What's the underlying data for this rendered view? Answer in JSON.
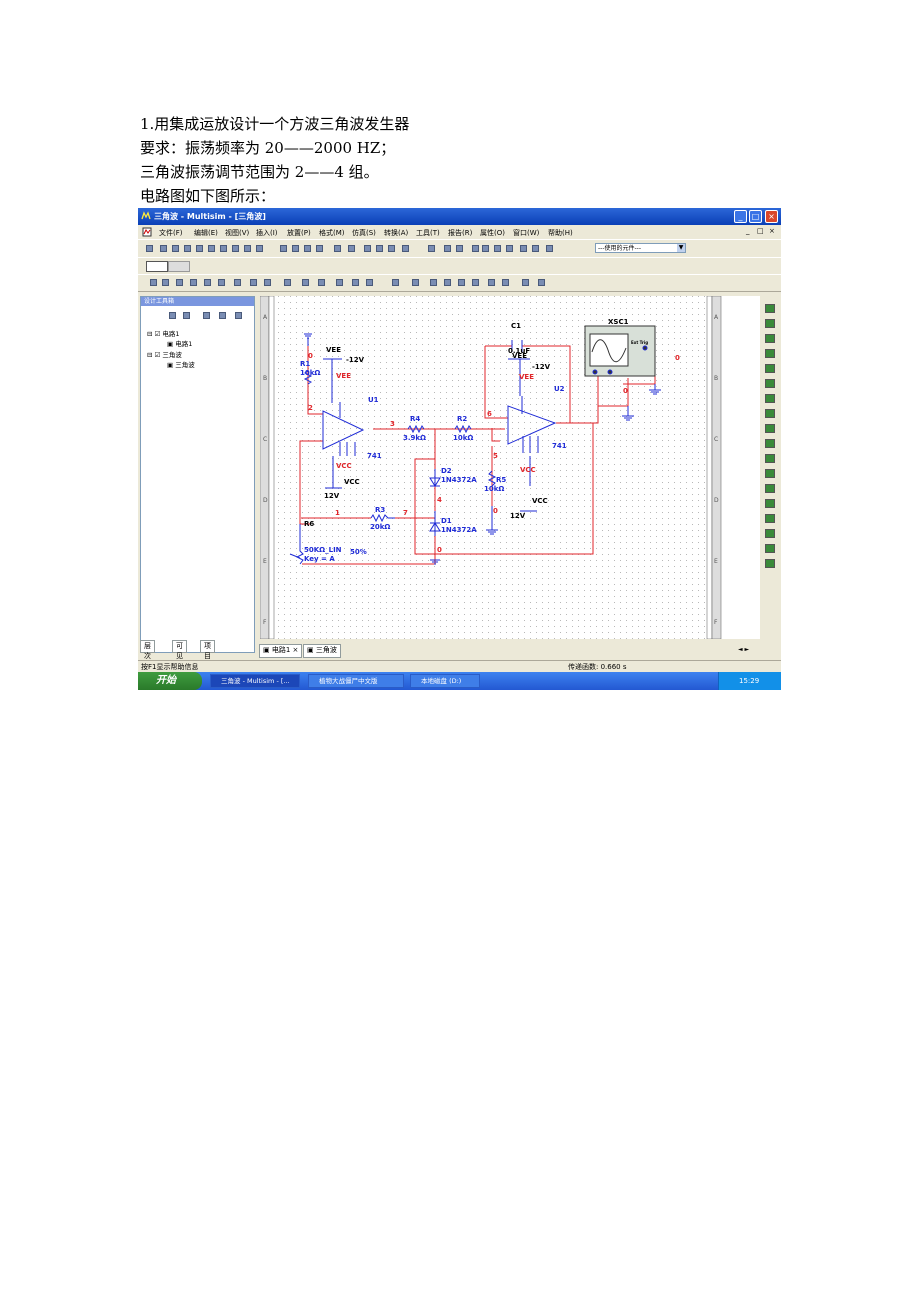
{
  "document": {
    "line1": "1.用集成运放设计一个方波三角波发生器",
    "line2": "要求：振荡频率为  20——2000 HZ；",
    "line3": "三角波振荡调节范围为  2——4 组。",
    "line4": "电路图如下图所示："
  },
  "window": {
    "title": "三角波 - Multisim - [三角波]",
    "controls": [
      "_",
      "□",
      "×"
    ]
  },
  "menu": [
    "文件(F)",
    "编辑(E)",
    "视图(V)",
    "插入(I)",
    "放置(P)",
    "格式(M)",
    "仿真(S)",
    "转换(A)",
    "工具(T)",
    "报告(R)",
    "属性(O)",
    "窗口(W)",
    "帮助(H)"
  ],
  "mdi_controls": [
    "_",
    "□",
    "×"
  ],
  "toolbar": {
    "combo_value": "---使用的元件---"
  },
  "design_toolbox": {
    "title": "设计工具箱",
    "tree": [
      {
        "label": "电路1",
        "checked": true
      },
      {
        "label": "电路1",
        "child": true
      },
      {
        "label": "三角波",
        "checked": true
      },
      {
        "label": "三角波",
        "child": true
      }
    ],
    "tabs": [
      "层次",
      "可见",
      "项目视图"
    ]
  },
  "schematic": {
    "border_rows": [
      "A",
      "B",
      "C",
      "D",
      "E",
      "F"
    ],
    "labels": {
      "r1": "R1",
      "r1v": "10kΩ",
      "vee1": "VEE",
      "vee1v": "-12V",
      "vee1pin": "VEE",
      "u1": "U1",
      "u1type": "741",
      "vcc1": "VCC",
      "vcc1pin": "VCC",
      "vcc1v": "12V",
      "r4": "R4",
      "r4v": "3.9kΩ",
      "r2": "R2",
      "r2v": "10kΩ",
      "c1": "C1",
      "c1v": "0.1uF",
      "vee2": "VEE",
      "vee2v": "-12V",
      "vee2pin": "VEE",
      "u2": "U2",
      "u2type": "741",
      "vcc2pin": "VCC",
      "vcc2": "VCC",
      "vcc2v": "12V",
      "d2": "D2",
      "d2v": "1N4372A",
      "d1": "D1",
      "d1v": "1N4372A",
      "r5": "R5",
      "r5v": "10kΩ",
      "r3": "R3",
      "r3v": "20kΩ",
      "r6": "R6",
      "r6v": "50KΩ_LIN",
      "r6key": "Key = A",
      "r6pct": "50%",
      "xsc": "XSC1",
      "ext": "Ext Trig"
    },
    "nets": {
      "n0a": "0",
      "n2": "2",
      "n3": "3",
      "n6": "6",
      "n5": "5",
      "n0b": "0",
      "n4": "4",
      "n1": "1",
      "n7": "7",
      "n0c": "0",
      "n0d": "0",
      "n0e": "0"
    }
  },
  "doc_tabs": [
    "电路1",
    "三角波"
  ],
  "status": {
    "left": "按F1显示帮助信息",
    "right": "传递函数: 0.660 s"
  },
  "taskbar": {
    "start": "开始",
    "items": [
      "三角波 - Multisim - [...",
      "植物大战僵尸中文版",
      "本地磁盘 (D:)"
    ],
    "time": "15:29"
  },
  "colors": {
    "wire": "#e0262b",
    "component": "#1f2bd6",
    "netlabel": "#e0262b",
    "grid": "#b8b8b8"
  }
}
